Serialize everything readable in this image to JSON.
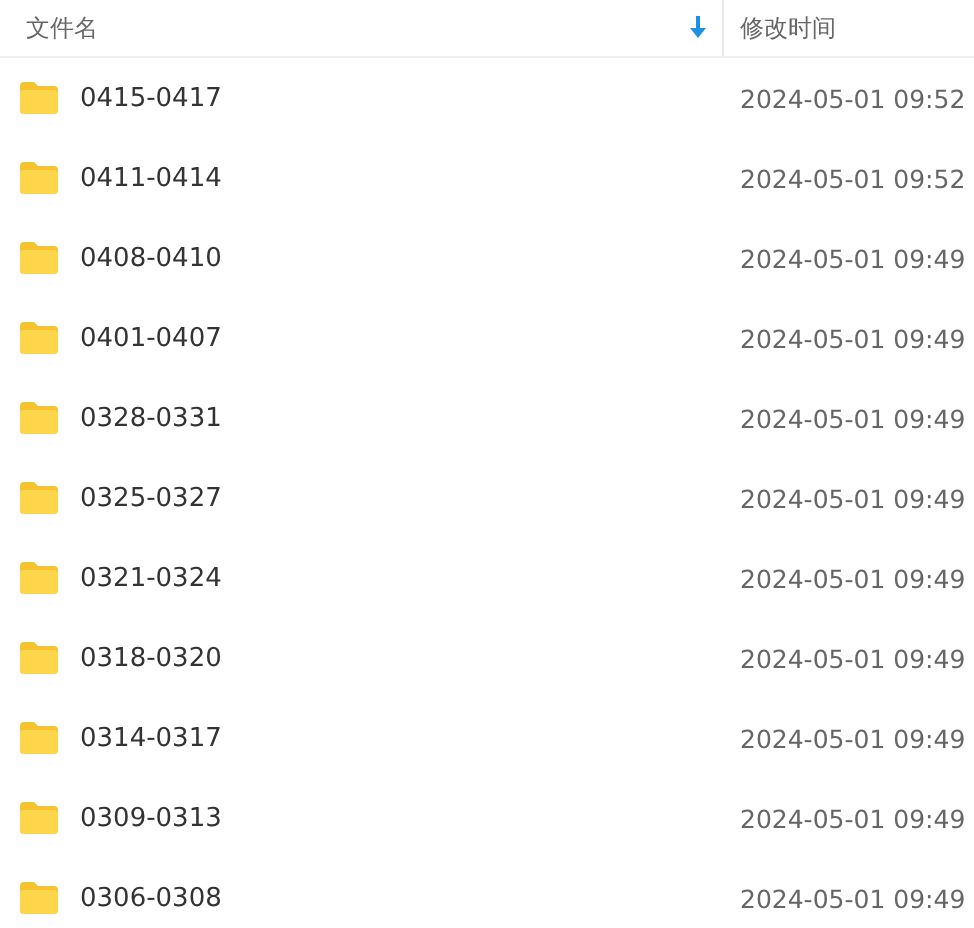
{
  "table": {
    "columns": [
      {
        "label": "文件名",
        "sorted": true
      },
      {
        "label": "修改时间",
        "sorted": false
      }
    ],
    "rows": [
      {
        "name": "0415-0417",
        "modified": "2024-05-01 09:52"
      },
      {
        "name": "0411-0414",
        "modified": "2024-05-01 09:52"
      },
      {
        "name": "0408-0410",
        "modified": "2024-05-01 09:49"
      },
      {
        "name": "0401-0407",
        "modified": "2024-05-01 09:49"
      },
      {
        "name": "0328-0331",
        "modified": "2024-05-01 09:49"
      },
      {
        "name": "0325-0327",
        "modified": "2024-05-01 09:49"
      },
      {
        "name": "0321-0324",
        "modified": "2024-05-01 09:49"
      },
      {
        "name": "0318-0320",
        "modified": "2024-05-01 09:49"
      },
      {
        "name": "0314-0317",
        "modified": "2024-05-01 09:49"
      },
      {
        "name": "0309-0313",
        "modified": "2024-05-01 09:49"
      },
      {
        "name": "0306-0308",
        "modified": "2024-05-01 09:49"
      }
    ]
  }
}
